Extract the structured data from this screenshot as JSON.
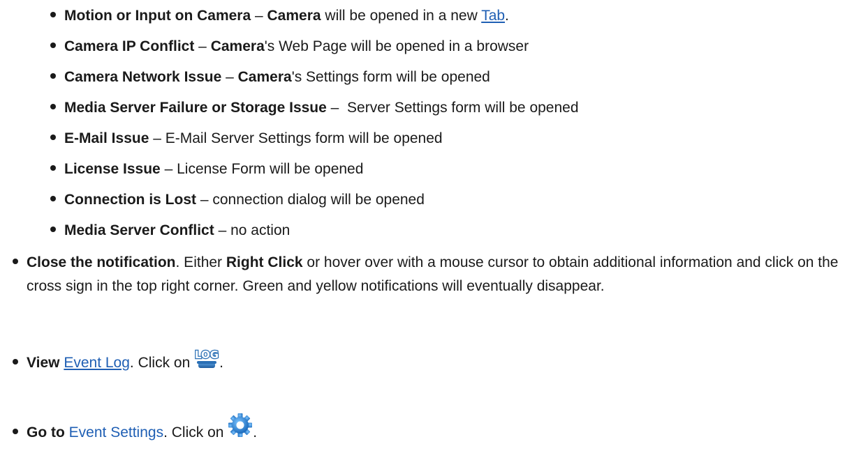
{
  "sub_items": [
    {
      "bold": "Motion or Input on Camera",
      "sep": " – ",
      "bold2": "Camera",
      "text": " will be opened in a new ",
      "link": "Tab",
      "tail": "."
    },
    {
      "bold": "Camera IP Conflict",
      "sep": " – ",
      "bold2": "Camera",
      "text": "'s Web Page will be opened in a browser"
    },
    {
      "bold": "Camera Network Issue",
      "sep": " – ",
      "bold2": "Camera",
      "text": "'s Settings form will be opened"
    },
    {
      "bold": "Media Server Failure or Storage Issue",
      "sep": " –  ",
      "text": "Server Settings form will be opened"
    },
    {
      "bold": "E-Mail Issue",
      "sep": " – ",
      "text": "E-Mail Server Settings form will be opened"
    },
    {
      "bold": "License Issue",
      "sep": " – ",
      "text": "License Form will be opened"
    },
    {
      "bold": "Connection is Lost",
      "sep": " – ",
      "text": "connection dialog will be opened"
    },
    {
      "bold": "Media Server Conflict",
      "sep": " – ",
      "text": "no action"
    }
  ],
  "close_item": {
    "bold": "Close the notification",
    "text1": ". Either ",
    "bold2": "Right Click",
    "text2": " or hover over with a mouse cursor to obtain additional information and click on the cross sign in the top right corner. Green and yellow notifications will eventually disappear."
  },
  "view_item": {
    "bold": "View",
    "link": "Event Log",
    "text": ". Click on ",
    "tail": ".",
    "icon": "log-icon"
  },
  "goto_item": {
    "bold": "Go to",
    "link": "Event Settings",
    "text": ". Click on ",
    "tail": ".",
    "icon": "gear-icon"
  },
  "colors": {
    "link": "#1f5fb4",
    "text": "#1a1a1a",
    "log_icon": "#2a6fb5",
    "gear_icon": "#1e7fd4"
  }
}
